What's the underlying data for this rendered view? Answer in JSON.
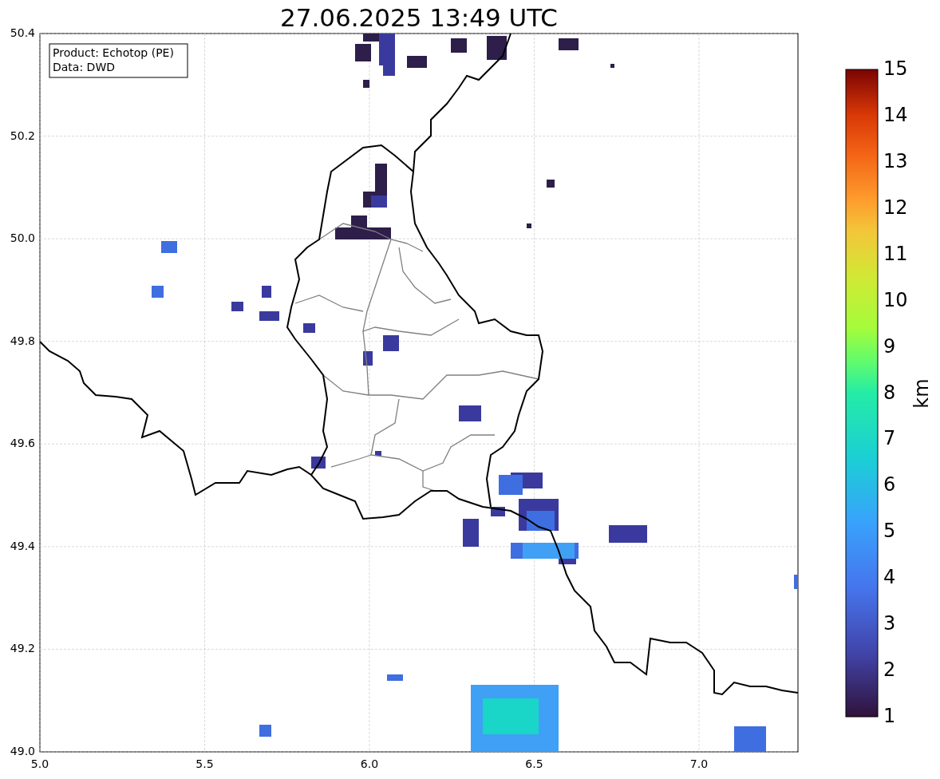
{
  "title": "27.06.2025 13:49 UTC",
  "legend": [
    "Product: Echotop (PE)",
    "Data: DWD"
  ],
  "x_axis": {
    "ticks": [
      "5.0",
      "5.5",
      "6.0",
      "6.5",
      "7.0"
    ]
  },
  "y_axis": {
    "ticks": [
      "50.4",
      "50.2",
      "50.0",
      "49.8",
      "49.6",
      "49.4",
      "49.2",
      "49.0"
    ]
  },
  "colorbar": {
    "ticks": [
      "15",
      "14",
      "13",
      "12",
      "11",
      "10",
      "9",
      "8",
      "7",
      "6",
      "5",
      "4",
      "3",
      "2",
      "1"
    ],
    "label": "km"
  }
}
